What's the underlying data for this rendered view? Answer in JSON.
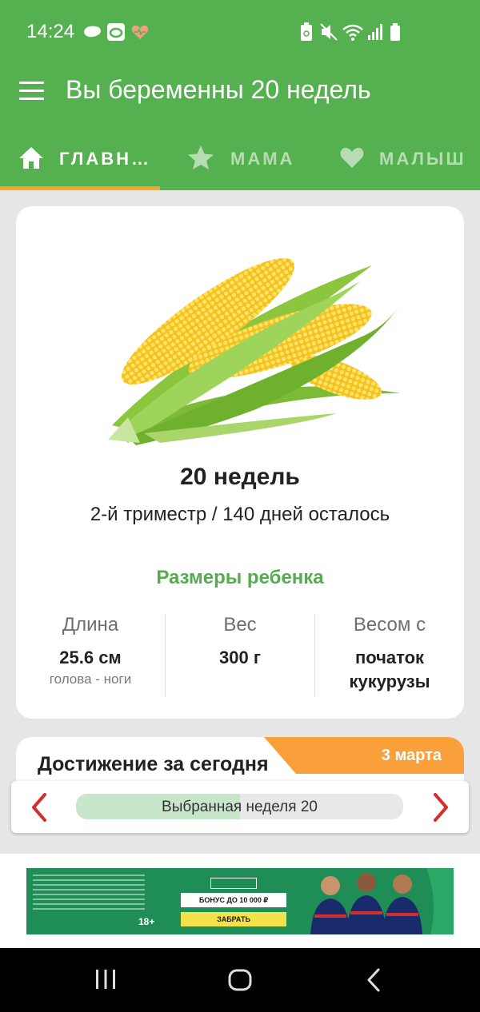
{
  "status_bar": {
    "time": "14:24"
  },
  "app_bar": {
    "title": "Вы беременны 20 недель"
  },
  "tabs": [
    {
      "label": "ГЛАВН…",
      "icon": "home-icon",
      "active": true
    },
    {
      "label": "МАМА",
      "icon": "star-icon",
      "active": false
    },
    {
      "label": "МАЛЫШ",
      "icon": "heart-icon",
      "active": false
    }
  ],
  "colors": {
    "primary": "#55b04f",
    "accent": "#f5a623",
    "size_title": "#52ad4d",
    "badge": "#f9a03a"
  },
  "pregnancy": {
    "weeks": "20 недель",
    "trimester_info": "2-й триместр / 140 дней осталось",
    "image": "corn-image"
  },
  "sizes": {
    "title": "Размеры ребенка",
    "length": {
      "label": "Длина",
      "value": "25.6 см",
      "sub": "голова - ноги"
    },
    "weight": {
      "label": "Вес",
      "value": "300 г"
    },
    "comparison": {
      "label": "Весом с",
      "value_line1": "початок",
      "value_line2": "кукурузы"
    }
  },
  "achievement": {
    "title": "Достижение за сегодня",
    "date": "3 марта"
  },
  "week_selector": {
    "label": "Выбранная неделя 20",
    "progress": 0.5
  },
  "ad": {
    "bonus": "БОНУС ДО 10 000 ₽",
    "cta": "ЗАБРАТЬ",
    "age": "18+"
  }
}
